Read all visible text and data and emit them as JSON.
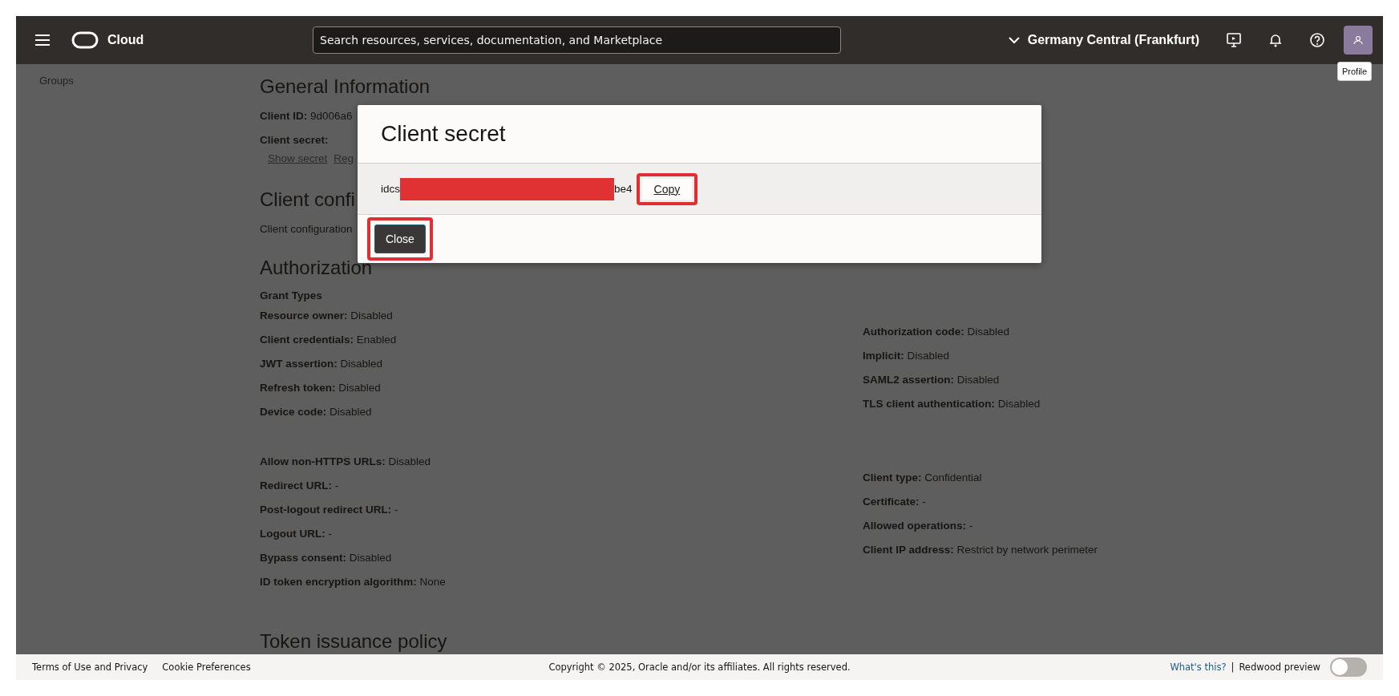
{
  "header": {
    "brand": "Cloud",
    "search": {
      "placeholder": "Search resources, services, documentation, and Marketplace"
    },
    "region": "Germany Central (Frankfurt)",
    "tooltip": "Profile"
  },
  "sidebar": {
    "items": [
      {
        "label": "Groups"
      }
    ]
  },
  "details": [
    {
      "kind": "heading",
      "text": "General Information"
    },
    {
      "kind": "field",
      "text": "**Client ID:** 9d006a6"
    },
    {
      "kind": "field",
      "text": "**Client secret:**"
    },
    {
      "kind": "links",
      "items": [
        "Show secret",
        "Reg"
      ]
    },
    {
      "kind": "heading",
      "text": "Client confi"
    },
    {
      "kind": "text",
      "text": "Client configuration"
    },
    {
      "kind": "heading",
      "text": "Authorization"
    },
    {
      "kind": "subheading",
      "text": "Grant Types"
    },
    {
      "kind": "columns",
      "left": [
        "**Resource owner:** Disabled",
        "**Client credentials:** Enabled",
        "**JWT assertion:** Disabled",
        "**Refresh token:** Disabled",
        "**Device code:** Disabled"
      ],
      "right": [
        "**Authorization code:** Disabled",
        "**Implicit:** Disabled",
        "**SAML2 assertion:** Disabled",
        "**TLS client authentication:** Disabled"
      ]
    },
    {
      "kind": "columns",
      "left": [
        "**Allow non-HTTPS URLs:** Disabled",
        "**Redirect URL:** -",
        "**Post-logout redirect URL:** -",
        "**Logout URL:** -",
        "**Bypass consent:** Disabled",
        "**ID token encryption algorithm:** None"
      ],
      "right": [
        "**Client type:** Confidential",
        "**Certificate:** -",
        "**Allowed operations:** -",
        "**Client IP address:** Restrict by network perimeter"
      ]
    },
    {
      "kind": "heading",
      "text": "Token issuance policy"
    }
  ],
  "dialog": {
    "title": "Client secret",
    "secret_start": "idcs",
    "secret_end": "be4",
    "copy": "Copy",
    "close": "Close"
  },
  "footer": {
    "links": [
      "Terms of Use and Privacy",
      "Cookie Preferences"
    ],
    "copyright": "Copyright © 2025, Oracle and/or its affiliates. All rights reserved.",
    "help": "What's this?",
    "separator": "|",
    "preview": {
      "label": "Redwood preview",
      "on": false
    }
  }
}
